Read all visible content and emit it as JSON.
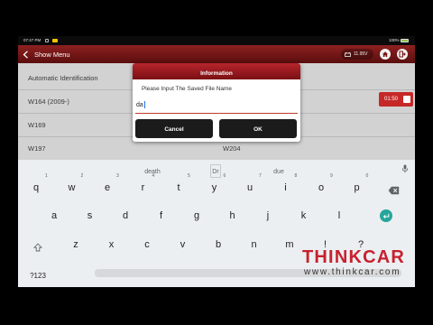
{
  "status_bar": {
    "time": "07:47 PM",
    "battery": "100%"
  },
  "header": {
    "back_label": "Show Menu",
    "voltage": "11.95V"
  },
  "list": {
    "rows": [
      {
        "left": "Automatic Identification"
      },
      {
        "left": "W164 (2009-)"
      },
      {
        "left": "W169"
      },
      {
        "left": "W197",
        "right": "W204"
      }
    ]
  },
  "timer": {
    "value": "01:50"
  },
  "dialog": {
    "title": "Information",
    "prompt": "Please Input The Saved File Name",
    "input_value": "da",
    "cancel_label": "Cancel",
    "ok_label": "OK"
  },
  "keyboard": {
    "suggestions": [
      "death",
      "Dr",
      "due"
    ],
    "row1": [
      {
        "label": "q",
        "hint": "1"
      },
      {
        "label": "w",
        "hint": "2"
      },
      {
        "label": "e",
        "hint": "3"
      },
      {
        "label": "r",
        "hint": "4"
      },
      {
        "label": "t",
        "hint": "5"
      },
      {
        "label": "y",
        "hint": "6"
      },
      {
        "label": "u",
        "hint": "7"
      },
      {
        "label": "i",
        "hint": "8"
      },
      {
        "label": "o",
        "hint": "9"
      },
      {
        "label": "p",
        "hint": "0"
      }
    ],
    "row2": [
      "a",
      "s",
      "d",
      "f",
      "g",
      "h",
      "j",
      "k",
      "l"
    ],
    "row3": [
      "z",
      "x",
      "c",
      "v",
      "b",
      "n",
      "m",
      "!",
      "?"
    ],
    "symbols_key": "?123"
  },
  "watermark": {
    "brand": "THINKCAR",
    "url": "www.thinkcar.com"
  },
  "icons": {
    "back": "chevron-left-icon",
    "voltage": "car-battery-icon",
    "home": "home-icon",
    "exit": "exit-icon",
    "timer_stop": "stop-square-icon",
    "mic": "microphone-icon",
    "backspace": "backspace-icon",
    "enter": "enter-icon",
    "shift": "shift-icon"
  },
  "colors": {
    "header_red": "#8e2020",
    "dialog_header_red": "#b6252c",
    "timer_badge": "#c62828",
    "dialog_button": "#1b1b1b",
    "enter_key": "#26a69a",
    "keyboard_bg": "#eceff1",
    "watermark_red": "#c8202f"
  }
}
